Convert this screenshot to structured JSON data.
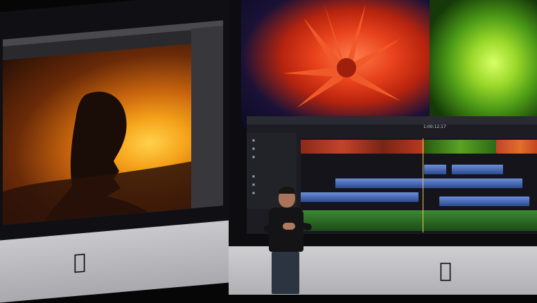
{
  "scene": {
    "description_free": true,
    "editor": {
      "timecode": "1:00:12:17",
      "sidebar_labels": [
        "",
        "",
        "",
        "",
        "",
        ""
      ]
    },
    "icons": [
      "apple-logo-icon",
      "apple-logo-icon"
    ],
    "colors": {
      "stage_background": "#060606",
      "sunset_orange": "#f5a21a",
      "flower_red": "#e8421c",
      "leaf_green": "#9ad82a",
      "timeline_blue": "#6c8fd8",
      "imac_silver": "#c9c9cc"
    }
  }
}
